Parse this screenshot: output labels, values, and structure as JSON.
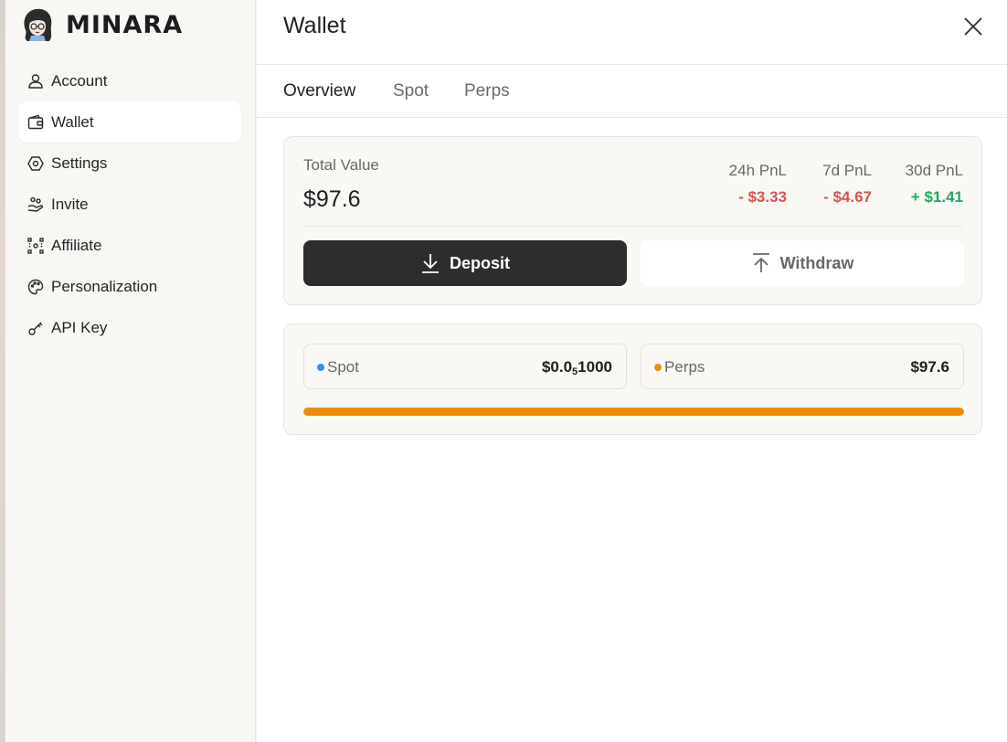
{
  "brand": {
    "name": "MINARA"
  },
  "sidebar": {
    "items": [
      {
        "label": "Account",
        "icon": "user-icon",
        "active": false
      },
      {
        "label": "Wallet",
        "icon": "wallet-icon",
        "active": true
      },
      {
        "label": "Settings",
        "icon": "settings-icon",
        "active": false
      },
      {
        "label": "Invite",
        "icon": "invite-icon",
        "active": false
      },
      {
        "label": "Affiliate",
        "icon": "affiliate-icon",
        "active": false
      },
      {
        "label": "Personalization",
        "icon": "palette-icon",
        "active": false
      },
      {
        "label": "API Key",
        "icon": "key-icon",
        "active": false
      }
    ]
  },
  "header": {
    "title": "Wallet"
  },
  "tabs": [
    {
      "label": "Overview",
      "active": true
    },
    {
      "label": "Spot",
      "active": false
    },
    {
      "label": "Perps",
      "active": false
    }
  ],
  "summary": {
    "total_label": "Total Value",
    "total_value": "$97.6",
    "pnl": [
      {
        "label": "24h PnL",
        "value": "- $3.33",
        "sign": "negative"
      },
      {
        "label": "7d PnL",
        "value": "- $4.67",
        "sign": "negative"
      },
      {
        "label": "30d PnL",
        "value": "+ $1.41",
        "sign": "positive"
      }
    ],
    "deposit_label": "Deposit",
    "withdraw_label": "Withdraw"
  },
  "allocation": {
    "spot": {
      "label": "Spot",
      "value_prefix": "$0.0",
      "value_subscript": "5",
      "value_suffix": "1000",
      "color": "#3b8ff0"
    },
    "perps": {
      "label": "Perps",
      "value": "$97.6",
      "color": "#f08c0a"
    },
    "perps_share": 1.0
  }
}
